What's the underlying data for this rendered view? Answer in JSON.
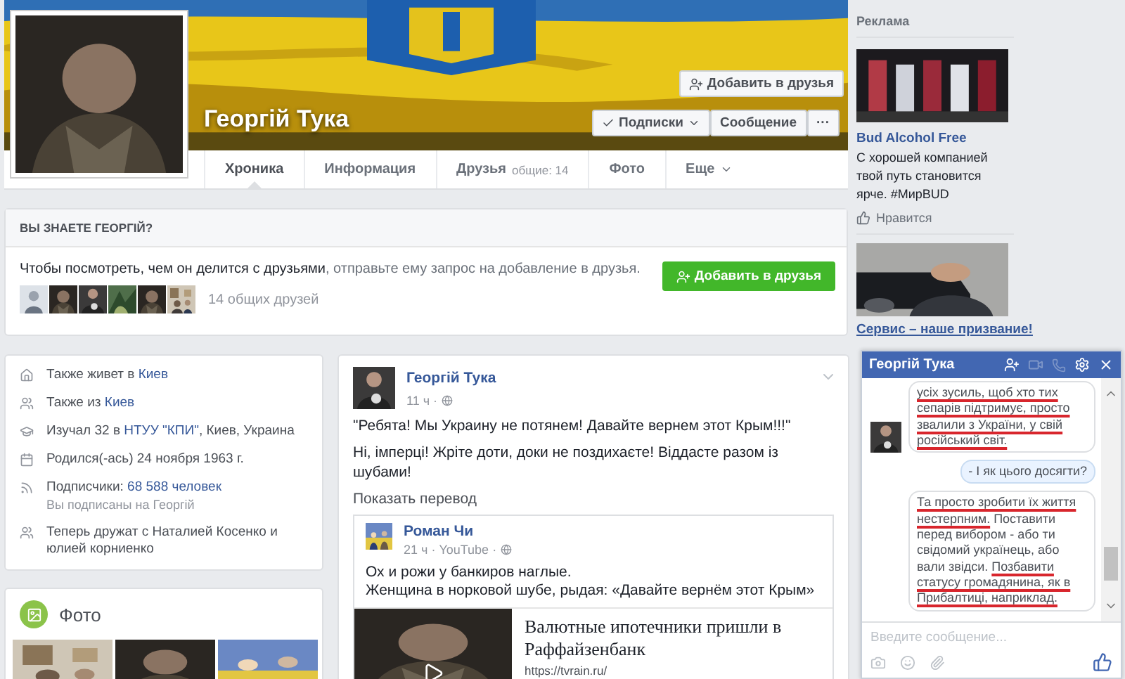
{
  "profile": {
    "name": "Георгій Тука",
    "add_friend": "Добавить в друзья",
    "follow": "Подписки",
    "message": "Сообщение",
    "more": "···"
  },
  "tabs": [
    {
      "label": "Хроника",
      "selected": true
    },
    {
      "label": "Информация",
      "selected": false
    },
    {
      "label": "Друзья",
      "count": "общие: 14",
      "selected": false
    },
    {
      "label": "Фото",
      "selected": false
    },
    {
      "label": "Еще",
      "dropdown": true,
      "selected": false
    }
  ],
  "know_card": {
    "title": "ВЫ ЗНАЕТЕ ГЕОРГІЙ?",
    "parts": [
      {
        "text": "Чтобы посмотреть, чем он делится с друзьями",
        "muted": false
      },
      {
        "text": ", отправьте ему запрос на добавление в друзья.",
        "muted": true
      }
    ],
    "button": "Добавить в друзья",
    "mutual": "14 общих друзей"
  },
  "intro": [
    {
      "parts": [
        {
          "text": "Также живет в ",
          "link": false
        },
        {
          "text": "Киев",
          "link": true
        }
      ]
    },
    {
      "parts": [
        {
          "text": "Также из ",
          "link": false
        },
        {
          "text": "Киев",
          "link": true
        }
      ]
    },
    {
      "parts": [
        {
          "text": "Изучал 32 в ",
          "link": false
        },
        {
          "text": "НТУУ \"КПИ\"",
          "link": true
        },
        {
          "text": ", Киев, Украина",
          "link": false
        }
      ]
    },
    {
      "parts": [
        {
          "text": "Родился(-ась) 24 ноября 1963 г.",
          "link": false
        }
      ]
    },
    {
      "parts": [
        {
          "text": "Подписчики: ",
          "link": false
        },
        {
          "text": "68 588 человек",
          "link": true
        }
      ],
      "sub": "Вы подписаны на Георгій"
    },
    {
      "parts": [
        {
          "text": "Теперь дружат с Наталией Косенко и юлией корниенко",
          "link": false
        }
      ]
    }
  ],
  "photos": {
    "title": "Фото"
  },
  "post": {
    "author": "Георгій Тука",
    "time": "11 ч ·",
    "lines": [
      "\"Ребята! Мы Украину не потянем! Давайте вернем этот Крым!!!\"",
      "Ні, імперці! Жріте доти, доки не поздихаєте! Віддасте разом із шубами!"
    ],
    "translate": "Показать перевод",
    "shared": {
      "author": "Роман Чи",
      "meta": "21 ч · YouTube ·",
      "lines": [
        "Ох и рожи у банкиров наглые.",
        "Женщина в норковой шубе, рыдая: «Давайте вернём этот Крым»"
      ],
      "link_title": "Валютные ипотечники пришли в Раффайзенбанк",
      "link_url": "https://tvrain.ru/"
    }
  },
  "ads": {
    "title": "Реклама",
    "items": [
      {
        "name": "Bud Alcohol Free",
        "text": "С хорошей компанией твой путь становится ярче. #МирBUD",
        "like": "Нравится"
      },
      {
        "name": "Сервис – наше призвание!"
      }
    ]
  },
  "chat": {
    "title": "Георгій Тука",
    "messages": [
      {
        "own": false,
        "avatar": true,
        "segments": [
          {
            "text": "усіх зусиль, щоб хто тих сепарів підтримує, просто звалили з України, у свій російський світ.",
            "underlined": true
          }
        ]
      },
      {
        "own": true,
        "avatar": false,
        "segments": [
          {
            "text": "- І як цього досягти?",
            "underlined": false
          }
        ]
      },
      {
        "own": false,
        "avatar": false,
        "segments": [
          {
            "text": "Та просто зробити їх життя нестерпним.",
            "underlined": true
          },
          {
            "text": " Поставити перед вибором - або ти свідомий українець, або вали звідси. ",
            "underlined": false
          },
          {
            "text": "Позбавити статусу громадянина, як в Прибалтиці, наприклад.",
            "underlined": true
          }
        ]
      }
    ],
    "placeholder": "Введите сообщение..."
  }
}
